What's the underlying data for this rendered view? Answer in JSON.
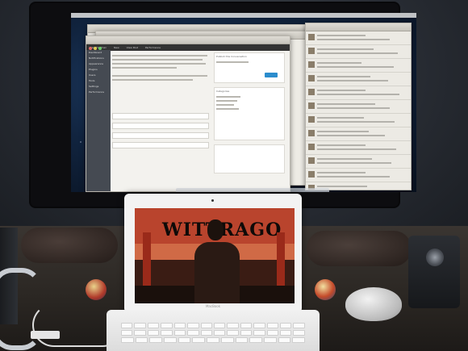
{
  "menubar": {
    "items": [
      "Mark Hoffman",
      "New",
      "View Post",
      "Performance"
    ]
  },
  "wp_sidebar": {
    "items": [
      "Dashboard",
      "Notifications",
      "Appearance",
      "Plugins",
      "Users",
      "Tools",
      "Settings",
      "Performance"
    ]
  },
  "wp_panel": {
    "publish_heading": "Publish this Conversation",
    "categories_heading": "Categories"
  },
  "laptop": {
    "bezel_label": "MacBook",
    "banner_text": "WITTRAGO"
  },
  "colors": {
    "banner": "#b9442d",
    "stage": "#d06a46",
    "wp_admin_bar": "#333333",
    "publish_button": "#2b8ccd"
  }
}
